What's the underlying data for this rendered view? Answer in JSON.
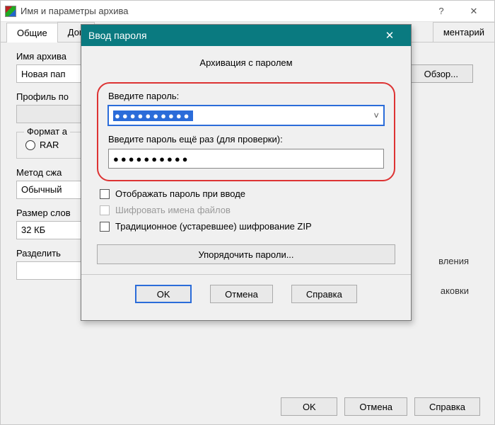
{
  "parent": {
    "title": "Имя и параметры архива",
    "tabs": {
      "active": "Общие",
      "partial_left": "Доп",
      "partial_right": "ментарий"
    },
    "archive_name_label": "Имя архива",
    "archive_name_value": "Новая пап",
    "profile_label": "Профиль по",
    "browse": "Обзор...",
    "format_label": "Формат а",
    "format_rar": "RAR",
    "method_label": "Метод сжа",
    "method_value": "Обычный",
    "right_text1": "вления",
    "right_text2": "аковки",
    "dict_label": "Размер слов",
    "dict_value": "32 КБ",
    "split_label": "Разделить",
    "ok": "OK",
    "cancel": "Отмена",
    "help": "Справка"
  },
  "modal": {
    "title": "Ввод пароля",
    "caption": "Архивация с паролем",
    "pwd1_label": "Введите пароль:",
    "pwd1_value": "●●●●●●●●●●",
    "pwd2_label": "Введите пароль ещё раз (для проверки):",
    "pwd2_value": "●●●●●●●●●●",
    "show_pwd": "Отображать пароль при вводе",
    "encrypt_names": "Шифровать имена файлов",
    "legacy_zip": "Традиционное (устаревшее) шифрование ZIP",
    "organize": "Упорядочить пароли...",
    "ok": "OK",
    "cancel": "Отмена",
    "help": "Справка"
  }
}
